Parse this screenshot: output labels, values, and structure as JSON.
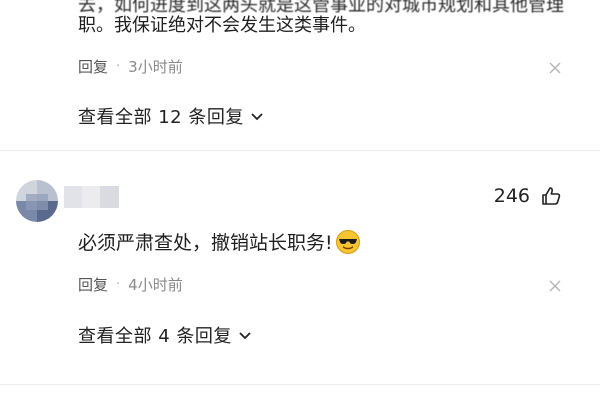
{
  "comment_top": {
    "cut_line": "去，如何进度到这两头就是这管事业的对城市规划和其他管理",
    "body_last_line": "职。我保证绝对不会发生这类事件。",
    "reply_label": "回复",
    "separator": "·",
    "time": "3小时前",
    "view_replies": "查看全部 12 条回复"
  },
  "comment_second": {
    "likes": "246",
    "text": "必须严肃查处，撤销站长职务!",
    "emoji": "sunglasses-emoji",
    "reply_label": "回复",
    "separator": "·",
    "time": "4小时前",
    "view_replies": "查看全部 4 条回复"
  },
  "colors": {
    "text": "#1f1f1f",
    "muted": "#8a8a8a",
    "divider": "#ececec"
  }
}
